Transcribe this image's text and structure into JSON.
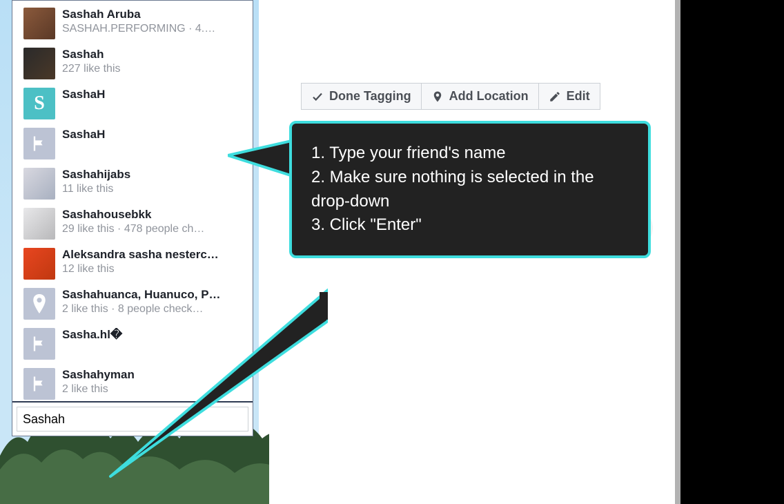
{
  "dropdown": {
    "items": [
      {
        "name": "Sashah Aruba",
        "sub": "SASHAH.PERFORMING · 4.…",
        "avatar": "photo1"
      },
      {
        "name": "Sashah",
        "sub": "227 like this",
        "avatar": "photo2"
      },
      {
        "name": "SashaH",
        "sub": "",
        "avatar": "s"
      },
      {
        "name": "SashaH",
        "sub": "",
        "avatar": "flag"
      },
      {
        "name": "Sashahijabs",
        "sub": "11 like this",
        "avatar": "photo3"
      },
      {
        "name": "Sashahousebkk",
        "sub": "29 like this · 478 people ch…",
        "avatar": "photo4"
      },
      {
        "name": "Aleksandra sasha nesterc…",
        "sub": "12 like this",
        "avatar": "photo5"
      },
      {
        "name": "Sashahuanca, Huanuco, P…",
        "sub": "2 like this · 8 people check…",
        "avatar": "pin"
      },
      {
        "name": "Sasha.hl�",
        "sub": "",
        "avatar": "flag"
      },
      {
        "name": "Sashahyman",
        "sub": "2 like this",
        "avatar": "flag"
      }
    ],
    "search_value": "Sashah "
  },
  "buttons": {
    "done_tagging": "Done Tagging",
    "add_location": "Add Location",
    "edit": "Edit"
  },
  "callout": {
    "line1": "1. Type your friend's name",
    "line2": "2. Make sure nothing is selected in the drop-down",
    "line3": "3. Click \"Enter\""
  }
}
